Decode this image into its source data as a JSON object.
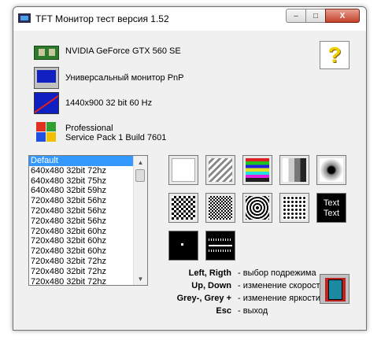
{
  "window": {
    "title": "TFT Монитор тест версия 1.52",
    "controls": {
      "minimize": "–",
      "maximize": "□",
      "close": "X"
    }
  },
  "info": {
    "gpu": "NVIDIA GeForce GTX 560 SE",
    "monitor": "Универсальный монитор PnP",
    "resolution": "1440x900 32 bit 60 Hz",
    "os_line1": "Professional",
    "os_line2": "Service Pack 1 Build 7601"
  },
  "help_button": {
    "label": "?"
  },
  "modes_list": {
    "selected_index": 0,
    "items": [
      "Default",
      "640x480  32bit  72hz",
      "640x480  32bit  75hz",
      "640x480  32bit  59hz",
      "720x480  32bit  56hz",
      "720x480  32bit  56hz",
      "720x480  32bit  56hz",
      "720x480  32bit  60hz",
      "720x480  32bit  60hz",
      "720x480  32bit  60hz",
      "720x480  32bit  72hz",
      "720x480  32bit  72hz",
      "720x480  32bit  72hz"
    ]
  },
  "test_buttons": [
    {
      "name": "white-fill"
    },
    {
      "name": "gray-gradient"
    },
    {
      "name": "color-bars"
    },
    {
      "name": "gray-bars"
    },
    {
      "name": "radial-gradient"
    },
    {
      "name": "checker-fine"
    },
    {
      "name": "grid-dots"
    },
    {
      "name": "concentric-circles"
    },
    {
      "name": "dotted-grid"
    },
    {
      "name": "text-test",
      "label_line1": "Text",
      "label_line2": "Text"
    },
    {
      "name": "single-pixel"
    },
    {
      "name": "ruler-lines"
    }
  ],
  "legend": [
    {
      "key": "Left, Rigth",
      "desc": "- выбор подрежима"
    },
    {
      "key": "Up, Down",
      "desc": "- изменение скорости"
    },
    {
      "key": "Grey-, Grey +",
      "desc": "- изменение яркости"
    },
    {
      "key": "Esc",
      "desc": "- выход"
    }
  ],
  "exit_button": {
    "icon": "door-exit-icon"
  }
}
